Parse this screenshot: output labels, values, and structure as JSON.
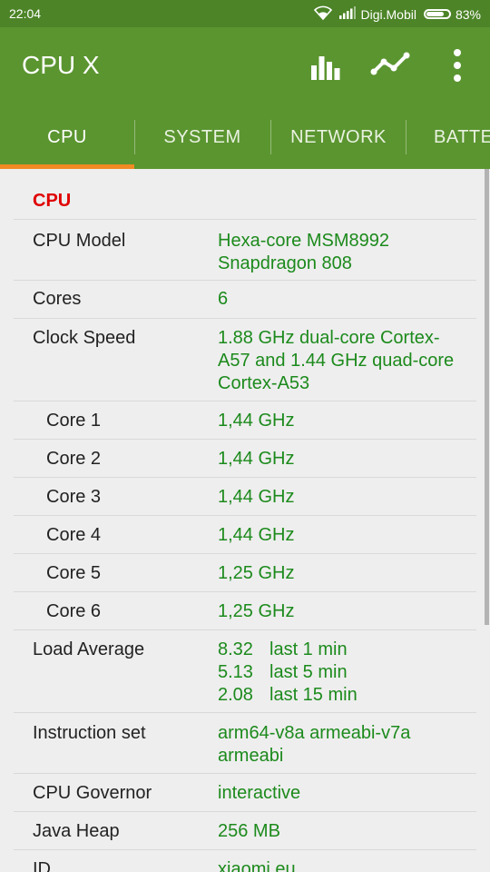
{
  "status_bar": {
    "time": "22:04",
    "carrier": "Digi.Mobil",
    "battery_percent": "83%",
    "battery_level": 0.83
  },
  "app_bar": {
    "title": "CPU X",
    "actions": [
      "bar-chart-icon",
      "line-chart-icon",
      "more-vert-icon"
    ]
  },
  "tabs": [
    {
      "label": "CPU",
      "active": true
    },
    {
      "label": "SYSTEM",
      "active": false
    },
    {
      "label": "NETWORK",
      "active": false
    },
    {
      "label": "BATTE",
      "active": false
    }
  ],
  "colors": {
    "status_bar": "#4c8427",
    "app_bar": "#5b9530",
    "tab_indicator": "#f08a24",
    "section_title": "#e00000",
    "value_text": "#1c8a1c"
  },
  "section": {
    "title": "CPU",
    "rows": [
      {
        "label": "CPU Model",
        "value": "Hexa-core MSM8992 Snapdragon 808"
      },
      {
        "label": "Cores",
        "value": "6"
      },
      {
        "label": "Clock Speed",
        "value": "1.88 GHz dual-core Cortex-A57 and 1.44 GHz quad-core Cortex-A53"
      },
      {
        "label": "Core 1",
        "value": "1,44 GHz"
      },
      {
        "label": "Core 2",
        "value": "1,44 GHz"
      },
      {
        "label": "Core 3",
        "value": "1,44 GHz"
      },
      {
        "label": "Core 4",
        "value": "1,44 GHz"
      },
      {
        "label": "Core 5",
        "value": "1,25 GHz"
      },
      {
        "label": "Core 6",
        "value": "1,25 GHz"
      },
      {
        "label": "Load Average",
        "lines": [
          {
            "num": "8.32",
            "text": "last 1 min"
          },
          {
            "num": "5.13",
            "text": "last 5 min"
          },
          {
            "num": "2.08",
            "text": "last 15 min"
          }
        ]
      },
      {
        "label": "Instruction set",
        "value": "arm64-v8a armeabi-v7a armeabi"
      },
      {
        "label": "CPU Governor",
        "value": "interactive"
      },
      {
        "label": "Java Heap",
        "value": "256 MB"
      },
      {
        "label": "ID",
        "value": "xiaomi.eu"
      }
    ]
  }
}
